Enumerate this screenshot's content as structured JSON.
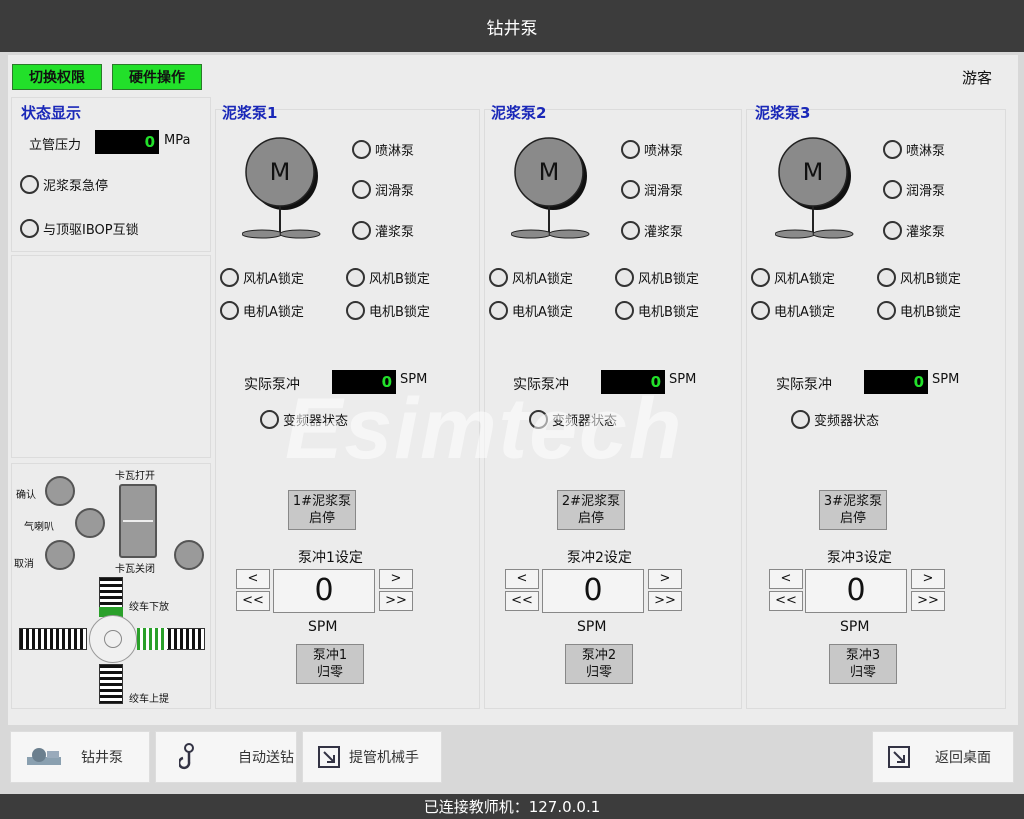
{
  "window": {
    "title": "钻井泵"
  },
  "toolbar": {
    "switch_perm": "切换权限",
    "hw_op": "硬件操作",
    "user": "游客"
  },
  "status_panel": {
    "title": "状态显示",
    "standpipe_label": "立管压力",
    "standpipe_value": "0",
    "standpipe_unit": "MPa",
    "estop": "泥浆泵急停",
    "ibop": "与顶驱IBOP互锁"
  },
  "control_panel": {
    "confirm": "确认",
    "horn": "气喇叭",
    "cancel": "取消",
    "slip_open": "卡瓦打开",
    "slip_close": "卡瓦关闭",
    "winch_down": "绞车下放",
    "winch_up": "绞车上提"
  },
  "pumps": [
    {
      "title": "泥浆泵1",
      "motor": "M",
      "spray": "喷淋泵",
      "lube": "润滑泵",
      "fill": "灌浆泵",
      "fan_a": "风机A锁定",
      "fan_b": "风机B锁定",
      "motor_a": "电机A锁定",
      "motor_b": "电机B锁定",
      "actual_label": "实际泵冲",
      "actual_value": "0",
      "actual_unit": "SPM",
      "vfd": "变频器状态",
      "start_l1": "1#泥浆泵",
      "start_l2": "启停",
      "set_label": "泵冲1设定",
      "set_value": "0",
      "set_unit": "SPM",
      "dec": "<",
      "dec_big": "<<",
      "inc": ">",
      "inc_big": ">>",
      "reset_l1": "泵冲1",
      "reset_l2": "归零"
    },
    {
      "title": "泥浆泵2",
      "motor": "M",
      "spray": "喷淋泵",
      "lube": "润滑泵",
      "fill": "灌浆泵",
      "fan_a": "风机A锁定",
      "fan_b": "风机B锁定",
      "motor_a": "电机A锁定",
      "motor_b": "电机B锁定",
      "actual_label": "实际泵冲",
      "actual_value": "0",
      "actual_unit": "SPM",
      "vfd": "变频器状态",
      "start_l1": "2#泥浆泵",
      "start_l2": "启停",
      "set_label": "泵冲2设定",
      "set_value": "0",
      "set_unit": "SPM",
      "dec": "<",
      "dec_big": "<<",
      "inc": ">",
      "inc_big": ">>",
      "reset_l1": "泵冲2",
      "reset_l2": "归零"
    },
    {
      "title": "泥浆泵3",
      "motor": "M",
      "spray": "喷淋泵",
      "lube": "润滑泵",
      "fill": "灌浆泵",
      "fan_a": "风机A锁定",
      "fan_b": "风机B锁定",
      "motor_a": "电机A锁定",
      "motor_b": "电机B锁定",
      "actual_label": "实际泵冲",
      "actual_value": "0",
      "actual_unit": "SPM",
      "vfd": "变频器状态",
      "start_l1": "3#泥浆泵",
      "start_l2": "启停",
      "set_label": "泵冲3设定",
      "set_value": "0",
      "set_unit": "SPM",
      "dec": "<",
      "dec_big": "<<",
      "inc": ">",
      "inc_big": ">>",
      "reset_l1": "泵冲3",
      "reset_l2": "归零"
    }
  ],
  "bottom_nav": {
    "drill_pump": "钻井泵",
    "auto_feed": "自动送钻",
    "pipe_handler": "提管机械手",
    "back_desktop": "返回桌面"
  },
  "status_bar": {
    "text": "已连接教师机：127.0.0.1"
  },
  "watermark": "Esimtech",
  "colors": {
    "accent_green": "#22e02a",
    "title_blue": "#1a28b8",
    "bar_dark": "#3c3c3c"
  }
}
